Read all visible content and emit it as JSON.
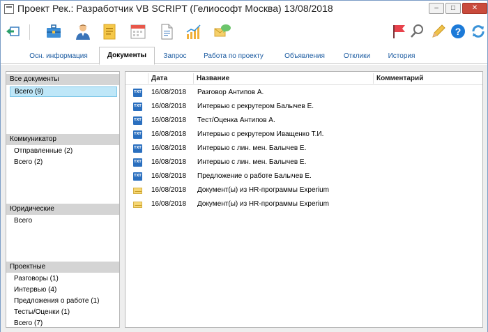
{
  "window": {
    "title": "Проект Рек.: Разработчик VB SCRIPT (Гелиософт Москва) 13/08/2018",
    "minimize": "–",
    "maximize": "□",
    "close": "✕"
  },
  "toolbar": {
    "icons": [
      "back-icon",
      "briefcase-icon",
      "person-icon",
      "notepad-icon",
      "calendar-icon",
      "document-icon",
      "chart-icon",
      "message-icon",
      "flag-icon",
      "search-icon",
      "pencil-icon",
      "help-icon",
      "refresh-icon"
    ],
    "colors": {
      "flag": "#e8424c",
      "help": "#1c7ad8",
      "refresh": "#3b93d8",
      "accent": "#1a5aa0"
    }
  },
  "tabs": [
    {
      "label": "Осн. информация"
    },
    {
      "label": "Документы",
      "active": true
    },
    {
      "label": "Запрос"
    },
    {
      "label": "Работа по проекту"
    },
    {
      "label": "Объявления"
    },
    {
      "label": "Отклики"
    },
    {
      "label": "История"
    }
  ],
  "groups": [
    {
      "header": "Все документы",
      "items": [
        "Всего (9)"
      ]
    },
    {
      "header": "Коммуникатор",
      "items": [
        "Отправленные (2)",
        "Всего (2)"
      ]
    },
    {
      "header": "Юридические",
      "items": [
        "Всего"
      ]
    },
    {
      "header": "Проектные",
      "items": [
        "Разговоры (1)",
        "Интервью (4)",
        "Предложения о работе (1)",
        "Тесты/Оценки (1)",
        "Всего (7)"
      ]
    }
  ],
  "table": {
    "columns": {
      "date": "Дата",
      "name": "Название",
      "comment": "Комментарий"
    },
    "rows": [
      {
        "icon": "txt",
        "date": "16/08/2018",
        "name": "Разговор Антипов А.",
        "comment": ""
      },
      {
        "icon": "txt",
        "date": "16/08/2018",
        "name": "Интервью с рекрутером Балычев Е.",
        "comment": ""
      },
      {
        "icon": "txt",
        "date": "16/08/2018",
        "name": "Тест/Оценка Антипов А.",
        "comment": ""
      },
      {
        "icon": "txt",
        "date": "16/08/2018",
        "name": "Интервью с рекрутером Иващенко Т.И.",
        "comment": ""
      },
      {
        "icon": "txt",
        "date": "16/08/2018",
        "name": "Интервью с лин. мен. Балычев Е.",
        "comment": ""
      },
      {
        "icon": "txt",
        "date": "16/08/2018",
        "name": "Интервью с лин. мен. Балычев Е.",
        "comment": ""
      },
      {
        "icon": "txt",
        "date": "16/08/2018",
        "name": "Предложение о работе Балычев Е.",
        "comment": ""
      },
      {
        "icon": "mail",
        "date": "16/08/2018",
        "name": "Документ(ы) из HR-программы Experium",
        "comment": ""
      },
      {
        "icon": "mail",
        "date": "16/08/2018",
        "name": "Документ(ы) из HR-программы Experium",
        "comment": ""
      }
    ]
  }
}
